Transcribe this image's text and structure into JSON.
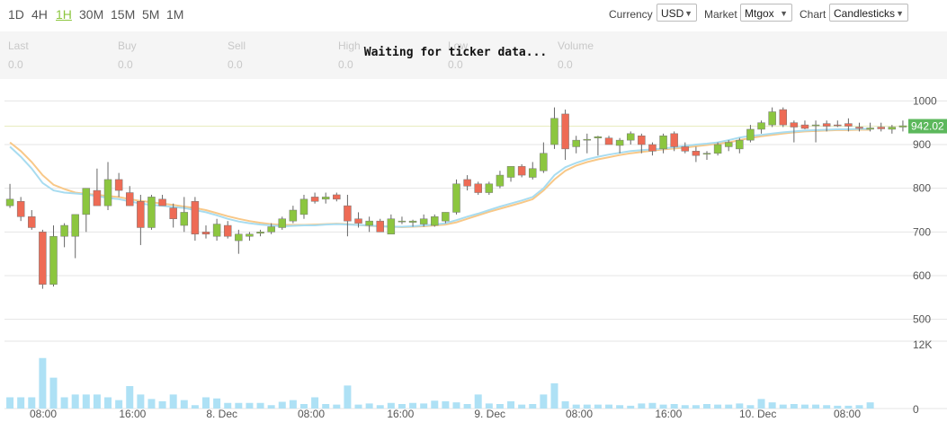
{
  "periods": [
    "1D",
    "4H",
    "1H",
    "30M",
    "15M",
    "5M",
    "1M"
  ],
  "active_period": "1H",
  "controls": {
    "currency_label": "Currency",
    "currency_value": "USD",
    "market_label": "Market",
    "market_value": "Mtgox",
    "chart_label": "Chart",
    "chart_value": "Candlesticks"
  },
  "ticker": {
    "labels": [
      "Last",
      "Buy",
      "Sell",
      "High",
      "Low",
      "Volume"
    ],
    "values": [
      "0.0",
      "0.0",
      "0.0",
      "0.0",
      "0.0",
      "0.0"
    ]
  },
  "waiting_text": "Waiting for ticker data...",
  "colors": {
    "up": "#8cc63f",
    "down": "#ee6b55",
    "ma_fast": "#a8dcf0",
    "ma_slow": "#f8c888",
    "volume": "#aee1f5",
    "price_line": "#e8ecbf",
    "badge": "#5cb85c",
    "accent": "#8cc63f"
  },
  "chart_data": {
    "type": "candlestick",
    "price_axis": {
      "min": 450,
      "max": 1050,
      "ticks": [
        500,
        600,
        700,
        800,
        900,
        1000
      ]
    },
    "volume_axis": {
      "min": 0,
      "max": 12000,
      "ticks": [
        0,
        12000
      ],
      "tick_labels": [
        "0",
        "12K"
      ]
    },
    "current_price": 942.02,
    "current_price_label": "942.02",
    "x_labels": [
      "08:00",
      "16:00",
      "8. Dec",
      "08:00",
      "16:00",
      "9. Dec",
      "08:00",
      "16:00",
      "10. Dec",
      "08:00"
    ],
    "candles": [
      {
        "o": 760,
        "h": 810,
        "l": 755,
        "c": 775
      },
      {
        "o": 770,
        "h": 780,
        "l": 725,
        "c": 735
      },
      {
        "o": 735,
        "h": 750,
        "l": 705,
        "c": 710
      },
      {
        "o": 700,
        "h": 705,
        "l": 570,
        "c": 580
      },
      {
        "o": 580,
        "h": 715,
        "l": 575,
        "c": 690
      },
      {
        "o": 690,
        "h": 720,
        "l": 665,
        "c": 715
      },
      {
        "o": 690,
        "h": 730,
        "l": 640,
        "c": 740
      },
      {
        "o": 740,
        "h": 800,
        "l": 700,
        "c": 800
      },
      {
        "o": 795,
        "h": 845,
        "l": 770,
        "c": 760
      },
      {
        "o": 760,
        "h": 860,
        "l": 750,
        "c": 820
      },
      {
        "o": 820,
        "h": 835,
        "l": 780,
        "c": 795
      },
      {
        "o": 790,
        "h": 805,
        "l": 760,
        "c": 760
      },
      {
        "o": 770,
        "h": 785,
        "l": 670,
        "c": 710
      },
      {
        "o": 710,
        "h": 785,
        "l": 705,
        "c": 780
      },
      {
        "o": 775,
        "h": 785,
        "l": 760,
        "c": 760
      },
      {
        "o": 755,
        "h": 765,
        "l": 710,
        "c": 730
      },
      {
        "o": 715,
        "h": 780,
        "l": 700,
        "c": 745
      },
      {
        "o": 770,
        "h": 780,
        "l": 680,
        "c": 695
      },
      {
        "o": 700,
        "h": 715,
        "l": 685,
        "c": 695
      },
      {
        "o": 690,
        "h": 730,
        "l": 680,
        "c": 718
      },
      {
        "o": 715,
        "h": 725,
        "l": 685,
        "c": 690
      },
      {
        "o": 680,
        "h": 705,
        "l": 650,
        "c": 695
      },
      {
        "o": 690,
        "h": 700,
        "l": 680,
        "c": 695
      },
      {
        "o": 697,
        "h": 705,
        "l": 690,
        "c": 700
      },
      {
        "o": 700,
        "h": 720,
        "l": 695,
        "c": 712
      },
      {
        "o": 710,
        "h": 735,
        "l": 705,
        "c": 730
      },
      {
        "o": 725,
        "h": 760,
        "l": 720,
        "c": 750
      },
      {
        "o": 740,
        "h": 785,
        "l": 730,
        "c": 775
      },
      {
        "o": 780,
        "h": 790,
        "l": 765,
        "c": 770
      },
      {
        "o": 775,
        "h": 790,
        "l": 765,
        "c": 780
      },
      {
        "o": 785,
        "h": 790,
        "l": 770,
        "c": 775
      },
      {
        "o": 760,
        "h": 785,
        "l": 690,
        "c": 725
      },
      {
        "o": 730,
        "h": 745,
        "l": 710,
        "c": 720
      },
      {
        "o": 715,
        "h": 735,
        "l": 700,
        "c": 725
      },
      {
        "o": 725,
        "h": 730,
        "l": 700,
        "c": 700
      },
      {
        "o": 695,
        "h": 740,
        "l": 695,
        "c": 730
      },
      {
        "o": 725,
        "h": 735,
        "l": 718,
        "c": 725
      },
      {
        "o": 722,
        "h": 728,
        "l": 712,
        "c": 725
      },
      {
        "o": 718,
        "h": 740,
        "l": 712,
        "c": 730
      },
      {
        "o": 715,
        "h": 740,
        "l": 712,
        "c": 735
      },
      {
        "o": 725,
        "h": 745,
        "l": 720,
        "c": 745
      },
      {
        "o": 745,
        "h": 820,
        "l": 740,
        "c": 810
      },
      {
        "o": 820,
        "h": 830,
        "l": 795,
        "c": 805
      },
      {
        "o": 810,
        "h": 815,
        "l": 785,
        "c": 790
      },
      {
        "o": 790,
        "h": 815,
        "l": 785,
        "c": 810
      },
      {
        "o": 805,
        "h": 840,
        "l": 800,
        "c": 830
      },
      {
        "o": 825,
        "h": 850,
        "l": 815,
        "c": 850
      },
      {
        "o": 850,
        "h": 855,
        "l": 825,
        "c": 830
      },
      {
        "o": 825,
        "h": 860,
        "l": 820,
        "c": 845
      },
      {
        "o": 840,
        "h": 905,
        "l": 835,
        "c": 880
      },
      {
        "o": 900,
        "h": 985,
        "l": 890,
        "c": 960
      },
      {
        "o": 970,
        "h": 980,
        "l": 865,
        "c": 890
      },
      {
        "o": 895,
        "h": 920,
        "l": 880,
        "c": 910
      },
      {
        "o": 910,
        "h": 925,
        "l": 880,
        "c": 912
      },
      {
        "o": 915,
        "h": 920,
        "l": 875,
        "c": 918
      },
      {
        "o": 915,
        "h": 920,
        "l": 900,
        "c": 900
      },
      {
        "o": 898,
        "h": 915,
        "l": 880,
        "c": 910
      },
      {
        "o": 910,
        "h": 930,
        "l": 900,
        "c": 925
      },
      {
        "o": 920,
        "h": 925,
        "l": 880,
        "c": 900
      },
      {
        "o": 900,
        "h": 905,
        "l": 875,
        "c": 885
      },
      {
        "o": 890,
        "h": 925,
        "l": 880,
        "c": 920
      },
      {
        "o": 925,
        "h": 930,
        "l": 885,
        "c": 895
      },
      {
        "o": 895,
        "h": 905,
        "l": 880,
        "c": 885
      },
      {
        "o": 885,
        "h": 895,
        "l": 860,
        "c": 875
      },
      {
        "o": 878,
        "h": 885,
        "l": 865,
        "c": 880
      },
      {
        "o": 880,
        "h": 905,
        "l": 875,
        "c": 900
      },
      {
        "o": 895,
        "h": 910,
        "l": 885,
        "c": 905
      },
      {
        "o": 890,
        "h": 915,
        "l": 880,
        "c": 910
      },
      {
        "o": 910,
        "h": 945,
        "l": 905,
        "c": 935
      },
      {
        "o": 935,
        "h": 955,
        "l": 925,
        "c": 950
      },
      {
        "o": 945,
        "h": 985,
        "l": 940,
        "c": 975
      },
      {
        "o": 980,
        "h": 985,
        "l": 940,
        "c": 945
      },
      {
        "o": 950,
        "h": 955,
        "l": 905,
        "c": 940
      },
      {
        "o": 945,
        "h": 955,
        "l": 935,
        "c": 937
      },
      {
        "o": 945,
        "h": 955,
        "l": 905,
        "c": 945
      },
      {
        "o": 948,
        "h": 955,
        "l": 930,
        "c": 942
      },
      {
        "o": 945,
        "h": 955,
        "l": 940,
        "c": 943
      },
      {
        "o": 948,
        "h": 960,
        "l": 930,
        "c": 942
      },
      {
        "o": 940,
        "h": 950,
        "l": 930,
        "c": 937
      },
      {
        "o": 935,
        "h": 950,
        "l": 930,
        "c": 938
      },
      {
        "o": 940,
        "h": 950,
        "l": 930,
        "c": 936
      },
      {
        "o": 935,
        "h": 945,
        "l": 925,
        "c": 940
      },
      {
        "o": 940,
        "h": 955,
        "l": 930,
        "c": 943
      }
    ],
    "ma_fast": [
      895,
      872,
      845,
      812,
      795,
      790,
      788,
      786,
      782,
      778,
      775,
      770,
      765,
      762,
      760,
      757,
      755,
      750,
      745,
      738,
      730,
      724,
      720,
      717,
      715,
      713,
      714,
      715,
      715,
      717,
      718,
      717,
      716,
      715,
      713,
      712,
      712,
      713,
      715,
      717,
      720,
      727,
      735,
      742,
      750,
      758,
      765,
      772,
      780,
      800,
      830,
      848,
      858,
      866,
      872,
      877,
      881,
      885,
      887,
      889,
      891,
      894,
      897,
      900,
      902,
      905,
      910,
      916,
      920,
      922,
      925,
      928,
      930,
      932,
      933,
      934,
      935,
      935,
      936,
      936
    ],
    "ma_slow": [
      905,
      885,
      860,
      830,
      808,
      798,
      790,
      787,
      785,
      782,
      780,
      775,
      771,
      768,
      765,
      762,
      758,
      755,
      750,
      743,
      736,
      730,
      725,
      721,
      718,
      716,
      716,
      716,
      717,
      718,
      719,
      718,
      716,
      714,
      713,
      712,
      711,
      712,
      713,
      715,
      717,
      722,
      730,
      738,
      746,
      753,
      760,
      767,
      775,
      795,
      820,
      840,
      852,
      860,
      866,
      871,
      876,
      880,
      883,
      886,
      889,
      891,
      893,
      896,
      899,
      902,
      905,
      910,
      915,
      919,
      922,
      925,
      928,
      930,
      931,
      932,
      933,
      933,
      934,
      934
    ],
    "volume": [
      2000,
      2000,
      2000,
      9000,
      5500,
      2000,
      2500,
      2500,
      2500,
      2000,
      1500,
      4000,
      2500,
      1700,
      1300,
      2500,
      1500,
      600,
      2000,
      1800,
      1000,
      1000,
      1000,
      1000,
      600,
      1200,
      1500,
      800,
      2000,
      800,
      700,
      4100,
      700,
      900,
      600,
      1000,
      800,
      1000,
      900,
      1400,
      1300,
      1100,
      800,
      2500,
      900,
      800,
      1300,
      700,
      800,
      2500,
      4500,
      1300,
      700,
      700,
      700,
      700,
      600,
      500,
      900,
      1000,
      700,
      800,
      600,
      600,
      800,
      700,
      700,
      900,
      600,
      1700,
      1100,
      700,
      800,
      700,
      700,
      600,
      500,
      500,
      600,
      1100
    ]
  }
}
